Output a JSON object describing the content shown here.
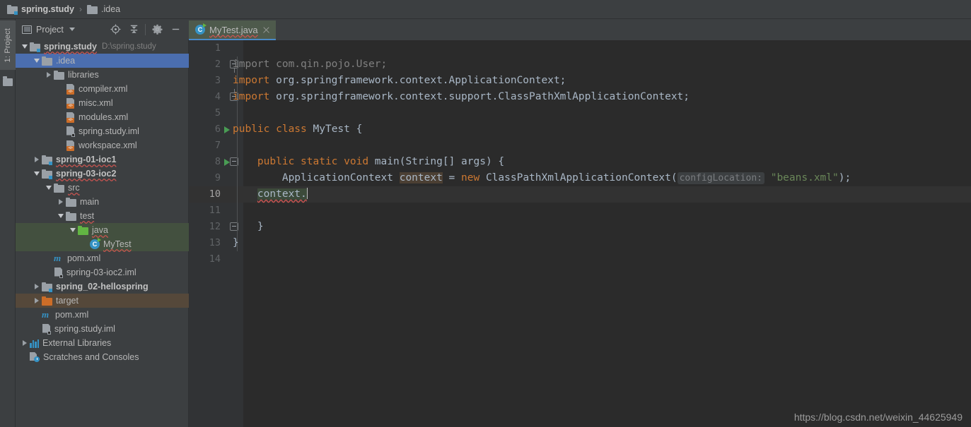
{
  "breadcrumb": {
    "items": [
      {
        "label": "spring.study",
        "icon": "module-folder-icon",
        "bold": true
      },
      {
        "label": ".idea",
        "icon": "folder-icon",
        "bold": false
      }
    ],
    "separator": "›"
  },
  "left_strip": {
    "project_tool_button": "1: Project",
    "folder_icon": "folder-icon"
  },
  "project_panel": {
    "title": "Project",
    "actions": [
      {
        "name": "locate-icon",
        "tooltip": "Select Opened File"
      },
      {
        "name": "collapse-all-icon",
        "tooltip": "Collapse All"
      },
      {
        "name": "gear-icon",
        "tooltip": "Settings"
      },
      {
        "name": "minimize-icon",
        "tooltip": "Hide"
      }
    ],
    "tree": [
      {
        "label": "spring.study",
        "suffix": "D:\\spring.study",
        "indent": 0,
        "twisty": "down",
        "icon": "module-folder-icon",
        "bold": true,
        "wavy": true,
        "state": "none"
      },
      {
        "label": ".idea",
        "suffix": "",
        "indent": 1,
        "twisty": "down",
        "icon": "folder-icon",
        "bold": false,
        "wavy": false,
        "state": "selected"
      },
      {
        "label": "libraries",
        "suffix": "",
        "indent": 2,
        "twisty": "right",
        "icon": "folder-icon",
        "bold": false,
        "wavy": false,
        "state": "none"
      },
      {
        "label": "compiler.xml",
        "suffix": "",
        "indent": 3,
        "twisty": "none",
        "icon": "xml-file-icon",
        "bold": false,
        "wavy": false,
        "state": "none"
      },
      {
        "label": "misc.xml",
        "suffix": "",
        "indent": 3,
        "twisty": "none",
        "icon": "xml-file-icon",
        "bold": false,
        "wavy": false,
        "state": "none"
      },
      {
        "label": "modules.xml",
        "suffix": "",
        "indent": 3,
        "twisty": "none",
        "icon": "xml-file-icon",
        "bold": false,
        "wavy": false,
        "state": "none"
      },
      {
        "label": "spring.study.iml",
        "suffix": "",
        "indent": 3,
        "twisty": "none",
        "icon": "iml-file-icon",
        "bold": false,
        "wavy": false,
        "state": "none"
      },
      {
        "label": "workspace.xml",
        "suffix": "",
        "indent": 3,
        "twisty": "none",
        "icon": "xml-file-icon",
        "bold": false,
        "wavy": false,
        "state": "none"
      },
      {
        "label": "spring-01-ioc1",
        "suffix": "",
        "indent": 1,
        "twisty": "right",
        "icon": "module-folder-icon",
        "bold": true,
        "wavy": true,
        "state": "none"
      },
      {
        "label": "spring-03-ioc2",
        "suffix": "",
        "indent": 1,
        "twisty": "down",
        "icon": "module-folder-icon",
        "bold": true,
        "wavy": true,
        "state": "none"
      },
      {
        "label": "src",
        "suffix": "",
        "indent": 2,
        "twisty": "down",
        "icon": "folder-icon",
        "bold": false,
        "wavy": true,
        "state": "none"
      },
      {
        "label": "main",
        "suffix": "",
        "indent": 3,
        "twisty": "right",
        "icon": "folder-icon",
        "bold": false,
        "wavy": false,
        "state": "none"
      },
      {
        "label": "test",
        "suffix": "",
        "indent": 3,
        "twisty": "down",
        "icon": "folder-icon",
        "bold": false,
        "wavy": true,
        "state": "none"
      },
      {
        "label": "java",
        "suffix": "",
        "indent": 4,
        "twisty": "down",
        "icon": "folder-green-icon",
        "bold": false,
        "wavy": true,
        "state": "src-test"
      },
      {
        "label": "MyTest",
        "suffix": "",
        "indent": 5,
        "twisty": "none",
        "icon": "java-class-icon",
        "bold": false,
        "wavy": true,
        "state": "src-test"
      },
      {
        "label": "pom.xml",
        "suffix": "",
        "indent": 2,
        "twisty": "none",
        "icon": "maven-pom-icon",
        "bold": false,
        "wavy": false,
        "state": "none"
      },
      {
        "label": "spring-03-ioc2.iml",
        "suffix": "",
        "indent": 2,
        "twisty": "none",
        "icon": "iml-file-icon",
        "bold": false,
        "wavy": false,
        "state": "none"
      },
      {
        "label": "spring_02-hellospring",
        "suffix": "",
        "indent": 1,
        "twisty": "right",
        "icon": "module-folder-icon",
        "bold": true,
        "wavy": false,
        "state": "none"
      },
      {
        "label": "target",
        "suffix": "",
        "indent": 1,
        "twisty": "right",
        "icon": "folder-orange-icon",
        "bold": false,
        "wavy": false,
        "state": "excluded"
      },
      {
        "label": "pom.xml",
        "suffix": "",
        "indent": 1,
        "twisty": "none",
        "icon": "maven-pom-icon",
        "bold": false,
        "wavy": false,
        "state": "none"
      },
      {
        "label": "spring.study.iml",
        "suffix": "",
        "indent": 1,
        "twisty": "none",
        "icon": "iml-file-icon",
        "bold": false,
        "wavy": false,
        "state": "none"
      },
      {
        "label": "External Libraries",
        "suffix": "",
        "indent": 0,
        "twisty": "right",
        "icon": "external-libraries-icon",
        "bold": false,
        "wavy": false,
        "state": "none"
      },
      {
        "label": "Scratches and Consoles",
        "suffix": "",
        "indent": 0,
        "twisty": "none",
        "icon": "scratches-icon",
        "bold": false,
        "wavy": false,
        "state": "none"
      }
    ]
  },
  "editor": {
    "tabs": [
      {
        "label": "MyTest.java",
        "icon": "java-class-icon",
        "active": true,
        "close_icon": "close-icon"
      }
    ],
    "current_line": 10,
    "lines": [
      {
        "n": 1,
        "fold": "none",
        "run": false,
        "segments": []
      },
      {
        "n": 2,
        "fold": "top",
        "run": false,
        "segments": [
          {
            "t": "import ",
            "c": "dim"
          },
          {
            "t": "com.qin.pojo.User;",
            "c": "dim"
          }
        ]
      },
      {
        "n": 3,
        "fold": "none",
        "run": false,
        "segments": [
          {
            "t": "import ",
            "c": "kw"
          },
          {
            "t": "org.springframework.context.ApplicationContext;",
            "c": "cls"
          }
        ]
      },
      {
        "n": 4,
        "fold": "bot",
        "run": false,
        "segments": [
          {
            "t": "import ",
            "c": "kw"
          },
          {
            "t": "org.springframework.context.support.ClassPathXmlApplicationContext;",
            "c": "cls"
          }
        ]
      },
      {
        "n": 5,
        "fold": "none",
        "run": false,
        "segments": []
      },
      {
        "n": 6,
        "fold": "none",
        "run": true,
        "segments": [
          {
            "t": "public class ",
            "c": "kw"
          },
          {
            "t": "MyTest ",
            "c": "cls"
          },
          {
            "t": "{",
            "c": "plain"
          }
        ]
      },
      {
        "n": 7,
        "fold": "none",
        "run": false,
        "segments": []
      },
      {
        "n": 8,
        "fold": "minus",
        "run": true,
        "segments": [
          {
            "t": "    ",
            "c": "plain"
          },
          {
            "t": "public static void ",
            "c": "kw"
          },
          {
            "t": "main",
            "c": "cls"
          },
          {
            "t": "(",
            "c": "plain"
          },
          {
            "t": "String",
            "c": "cls"
          },
          {
            "t": "[] args) {",
            "c": "plain"
          }
        ]
      },
      {
        "n": 9,
        "fold": "none",
        "run": false,
        "segments": [
          {
            "t": "        ",
            "c": "plain"
          },
          {
            "t": "ApplicationContext ",
            "c": "cls"
          },
          {
            "t": "context",
            "c": "ident"
          },
          {
            "t": " = ",
            "c": "plain"
          },
          {
            "t": "new ",
            "c": "kw"
          },
          {
            "t": "ClassPathXmlApplicationContext(",
            "c": "cls"
          },
          {
            "t": "configLocation:",
            "c": "hint"
          },
          {
            "t": " ",
            "c": "plain"
          },
          {
            "t": "\"beans.xml\"",
            "c": "str"
          },
          {
            "t": ");",
            "c": "plain"
          }
        ]
      },
      {
        "n": 10,
        "fold": "none",
        "run": false,
        "segments": [
          {
            "t": "    ",
            "c": "plain"
          },
          {
            "t": "context.",
            "c": "caretline"
          },
          {
            "t": "CARET",
            "c": "caret"
          }
        ]
      },
      {
        "n": 11,
        "fold": "none",
        "run": false,
        "segments": []
      },
      {
        "n": 12,
        "fold": "minus-end",
        "run": false,
        "segments": [
          {
            "t": "    }",
            "c": "plain"
          }
        ]
      },
      {
        "n": 13,
        "fold": "none",
        "run": false,
        "segments": [
          {
            "t": "}",
            "c": "plain"
          }
        ]
      },
      {
        "n": 14,
        "fold": "none",
        "run": false,
        "segments": []
      }
    ]
  },
  "watermark": "https://blog.csdn.net/weixin_44625949",
  "colors": {
    "panel_bg": "#3c3f41",
    "editor_bg": "#2b2b2b",
    "gutter_bg": "#313335",
    "selection_blue": "#4b6eaf",
    "test_source_green": "#43503f",
    "excluded_brown": "#55483a",
    "keyword_orange": "#cc7832",
    "string_green": "#6a8759",
    "identifier_gray": "#a9b7c6",
    "run_arrow_green": "#499c54",
    "accent_blue": "#3592c4",
    "error_wavy_red": "#c75450"
  }
}
